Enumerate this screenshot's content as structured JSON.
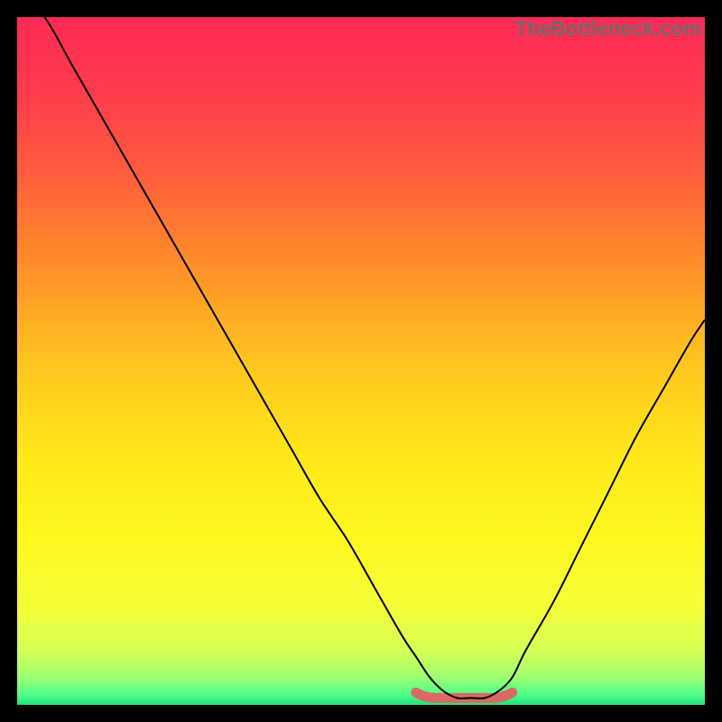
{
  "watermark": "TheBottleneck.com",
  "colors": {
    "border": "#000000",
    "gradient_stops": [
      {
        "offset": 0.0,
        "color": "#ff2a55"
      },
      {
        "offset": 0.1,
        "color": "#ff3a4e"
      },
      {
        "offset": 0.22,
        "color": "#ff5a3d"
      },
      {
        "offset": 0.35,
        "color": "#ff8a2a"
      },
      {
        "offset": 0.5,
        "color": "#ffc41f"
      },
      {
        "offset": 0.64,
        "color": "#ffe81a"
      },
      {
        "offset": 0.76,
        "color": "#fff81f"
      },
      {
        "offset": 0.86,
        "color": "#f4ff3a"
      },
      {
        "offset": 0.92,
        "color": "#d6ff55"
      },
      {
        "offset": 0.96,
        "color": "#9eff70"
      },
      {
        "offset": 0.985,
        "color": "#4dff8a"
      },
      {
        "offset": 1.0,
        "color": "#22e07a"
      }
    ],
    "curve": "#000000",
    "marker": "#d86a63"
  },
  "chart_data": {
    "type": "line",
    "title": "",
    "xlabel": "",
    "ylabel": "",
    "xlim": [
      0,
      100
    ],
    "ylim": [
      0,
      100
    ],
    "series": [
      {
        "name": "bottleneck-curve",
        "x": [
          0,
          4,
          8,
          12,
          16,
          20,
          24,
          28,
          32,
          36,
          40,
          44,
          48,
          52,
          56,
          58,
          60,
          62,
          64,
          66,
          68,
          70,
          72,
          74,
          78,
          82,
          86,
          90,
          94,
          98,
          100
        ],
        "y": [
          104,
          100,
          93,
          86,
          79,
          72,
          65,
          58,
          51,
          44,
          37,
          30,
          24,
          17,
          10,
          7,
          4,
          2,
          1,
          1,
          1,
          2,
          4,
          8,
          15,
          23,
          31,
          39,
          46,
          53,
          56
        ]
      }
    ],
    "flat_region": {
      "x_start": 58,
      "x_end": 72,
      "y": 1.4
    }
  }
}
